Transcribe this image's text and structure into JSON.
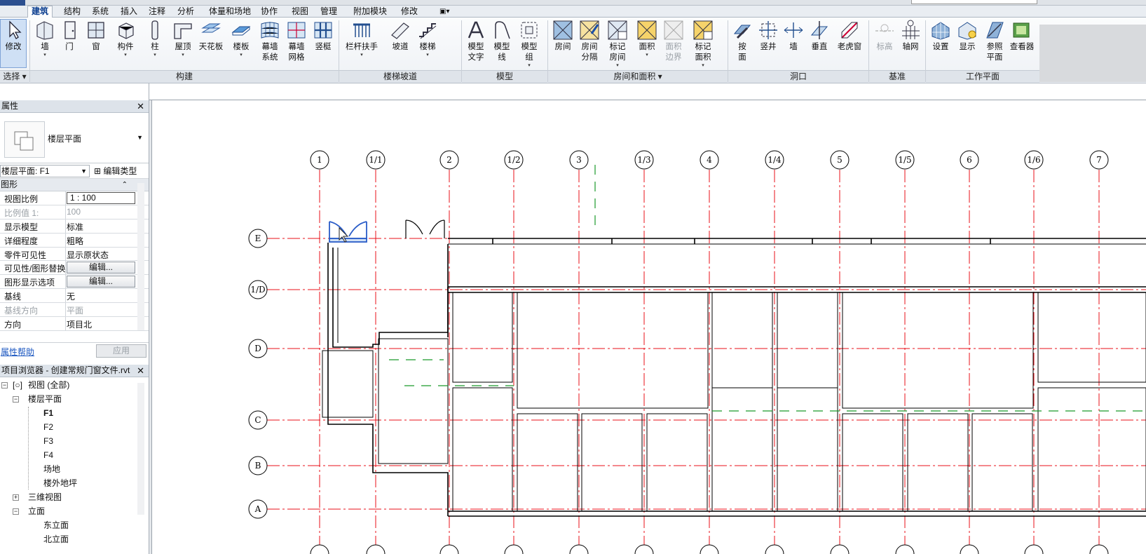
{
  "ribbon": {
    "tabs": [
      "建筑",
      "结构",
      "系统",
      "插入",
      "注释",
      "分析",
      "体量和场地",
      "协作",
      "视图",
      "管理",
      "附加模块",
      "修改",
      "▣▾"
    ],
    "active_tab": "建筑",
    "tools": [
      {
        "id": "modify",
        "label": "修改"
      },
      {
        "id": "wall",
        "label": "墙"
      },
      {
        "id": "door",
        "label": "门"
      },
      {
        "id": "window",
        "label": "窗"
      },
      {
        "id": "component",
        "label": "构件"
      },
      {
        "id": "column",
        "label": "柱"
      },
      {
        "id": "roof",
        "label": "屋顶"
      },
      {
        "id": "ceiling",
        "label": "天花板"
      },
      {
        "id": "floor",
        "label": "楼板"
      },
      {
        "id": "curtain-system",
        "label": "幕墙\n系统"
      },
      {
        "id": "curtain-grid",
        "label": "幕墙\n网格"
      },
      {
        "id": "mullion",
        "label": "竖梃"
      },
      {
        "id": "railing",
        "label": "栏杆扶手"
      },
      {
        "id": "ramp",
        "label": "坡道"
      },
      {
        "id": "stair",
        "label": "楼梯"
      },
      {
        "id": "model-text",
        "label": "模型\n文字"
      },
      {
        "id": "model-line",
        "label": "模型\n线"
      },
      {
        "id": "model-group",
        "label": "模型\n组"
      },
      {
        "id": "room",
        "label": "房间"
      },
      {
        "id": "room-separator",
        "label": "房间\n分隔"
      },
      {
        "id": "tag-room",
        "label": "标记\n房间"
      },
      {
        "id": "area",
        "label": "面积"
      },
      {
        "id": "area-boundary",
        "label": "面积\n边界"
      },
      {
        "id": "tag-area",
        "label": "标记\n面积"
      },
      {
        "id": "by-face",
        "label": "按\n面"
      },
      {
        "id": "shaft",
        "label": "竖井"
      },
      {
        "id": "wall-opening",
        "label": "墙"
      },
      {
        "id": "vertical",
        "label": "垂直"
      },
      {
        "id": "dormer",
        "label": "老虎窗"
      },
      {
        "id": "level",
        "label": "标高"
      },
      {
        "id": "grid",
        "label": "轴网"
      },
      {
        "id": "set",
        "label": "设置"
      },
      {
        "id": "show",
        "label": "显示"
      },
      {
        "id": "ref-plane",
        "label": "参照\n平面"
      },
      {
        "id": "viewer",
        "label": "查看器"
      }
    ],
    "panels": {
      "select": "选择 ▾",
      "build": "构建",
      "circulation": "楼梯坡道",
      "model": "模型",
      "room_area": "房间和面积 ▾",
      "opening": "洞口",
      "datum": "基准",
      "workplane": "工作平面"
    }
  },
  "properties": {
    "title": "属性",
    "type_name": "楼层平面",
    "selector": "楼层平面: F1",
    "edit_type": "编辑类型",
    "group": "图形",
    "rows": [
      {
        "k": "视图比例",
        "v": "1 : 100"
      },
      {
        "k": "比例值 1:",
        "v": "100"
      },
      {
        "k": "显示模型",
        "v": "标准"
      },
      {
        "k": "详细程度",
        "v": "粗略"
      },
      {
        "k": "零件可见性",
        "v": "显示原状态"
      },
      {
        "k": "可见性/图形替换",
        "v": "编辑..."
      },
      {
        "k": "图形显示选项",
        "v": "编辑..."
      },
      {
        "k": "基线",
        "v": "无"
      },
      {
        "k": "基线方向",
        "v": "平面"
      },
      {
        "k": "方向",
        "v": "项目北"
      }
    ],
    "help": "属性帮助",
    "apply": "应用"
  },
  "browser": {
    "title": "项目浏览器 - 创建常规门窗文件.rvt",
    "views_all": "视图 (全部)",
    "floor_plans": "楼层平面",
    "plans": [
      "F1",
      "F2",
      "F3",
      "F4",
      "场地",
      "楼外地坪"
    ],
    "views3d": "三维视图",
    "elevations": "立面",
    "elev_items": [
      "东立面",
      "北立面"
    ]
  },
  "drawing": {
    "grid_columns": [
      "1",
      "1/1",
      "2",
      "1/2",
      "3",
      "1/3",
      "4",
      "1/4",
      "5",
      "1/5",
      "6",
      "1/6",
      "7"
    ],
    "grid_rows": [
      "E",
      "1/D",
      "D",
      "C",
      "B",
      "A"
    ]
  },
  "colors": {
    "grid_line": "#e8101a",
    "dashed_line": "#1a9a2a",
    "selection": "#2a5cc8",
    "active_tab": "#0a3d8f"
  }
}
